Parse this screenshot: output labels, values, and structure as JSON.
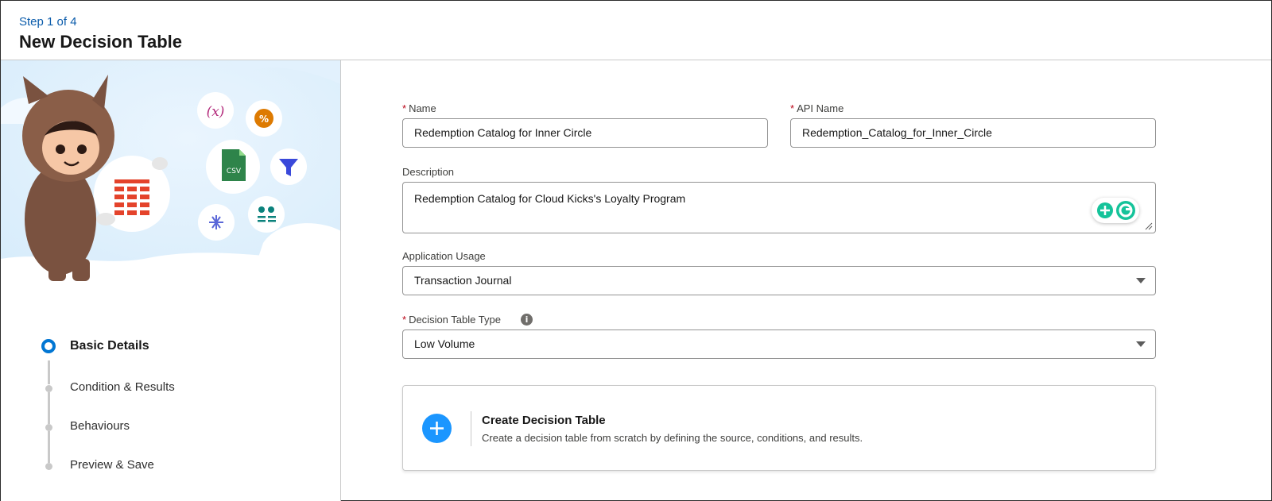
{
  "header": {
    "step": "Step 1 of 4",
    "title": "New Decision Table"
  },
  "progress": {
    "steps": [
      {
        "label": "Basic Details",
        "state": "current"
      },
      {
        "label": "Condition & Results",
        "state": "upcoming"
      },
      {
        "label": "Behaviours",
        "state": "upcoming"
      },
      {
        "label": "Preview & Save",
        "state": "upcoming"
      }
    ]
  },
  "form": {
    "name": {
      "label": "Name",
      "required": true,
      "value": "Redemption Catalog for Inner Circle"
    },
    "api_name": {
      "label": "API Name",
      "required": true,
      "value": "Redemption_Catalog_for_Inner_Circle"
    },
    "description": {
      "label": "Description",
      "value": "Redemption Catalog for Cloud Kicks's Loyalty Program"
    },
    "application_usage": {
      "label": "Application Usage",
      "value": "Transaction Journal"
    },
    "decision_table_type": {
      "label": "Decision Table Type",
      "required": true,
      "value": "Low Volume",
      "info_icon": "info-icon"
    }
  },
  "create_card": {
    "title": "Create Decision Table",
    "description": "Create a decision table from scratch by defining the source, conditions, and results.",
    "icon": "plus-icon"
  },
  "hero_icons": {
    "csv_label": "CSV",
    "percent_label": "%",
    "variable_label": "(x)"
  },
  "colors": {
    "brand_blue": "#0176d3",
    "step_blue": "#0b5cab",
    "plus_blue": "#1b96ff",
    "required_red": "#ba0517",
    "table_icon_red": "#e4432b",
    "csv_green": "#2e844a"
  }
}
